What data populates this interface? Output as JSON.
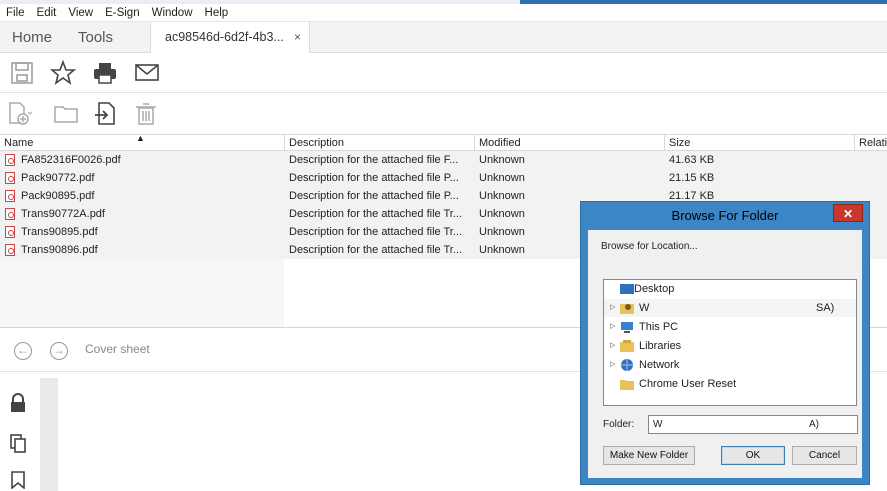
{
  "menu": [
    "File",
    "Edit",
    "View",
    "E-Sign",
    "Window",
    "Help"
  ],
  "tabs": {
    "home": "Home",
    "tools": "Tools",
    "document": "ac98546d-6d2f-4b3...",
    "close": "×"
  },
  "columns": {
    "name": "Name",
    "description": "Description",
    "modified": "Modified",
    "size": "Size",
    "related": "Relati"
  },
  "files": [
    {
      "name": "FA852316F0026.pdf",
      "description": "Description for the attached file F...",
      "modified": "Unknown",
      "size": "41.63 KB"
    },
    {
      "name": "Pack90772.pdf",
      "description": "Description for the attached file P...",
      "modified": "Unknown",
      "size": "21.15 KB"
    },
    {
      "name": "Pack90895.pdf",
      "description": "Description for the attached file P...",
      "modified": "Unknown",
      "size": "21.17 KB"
    },
    {
      "name": "Trans90772A.pdf",
      "description": "Description for the attached file Tr...",
      "modified": "Unknown",
      "size": ""
    },
    {
      "name": "Trans90895.pdf",
      "description": "Description for the attached file Tr...",
      "modified": "Unknown",
      "size": ""
    },
    {
      "name": "Trans90896.pdf",
      "description": "Description for the attached file Tr...",
      "modified": "Unknown",
      "size": ""
    }
  ],
  "page_nav": {
    "cover_sheet": "Cover sheet"
  },
  "dialog": {
    "title": "Browse For Folder",
    "close": "✕",
    "prompt": "Browse for Location...",
    "tree": [
      {
        "label": "Desktop",
        "icon": "desktop-icon",
        "arrow": ""
      },
      {
        "label": "W",
        "suffix": "SA)",
        "icon": "user-folder-icon",
        "arrow": "▷"
      },
      {
        "label": "This PC",
        "icon": "computer-icon",
        "arrow": "▷"
      },
      {
        "label": "Libraries",
        "icon": "libraries-icon",
        "arrow": "▷"
      },
      {
        "label": "Network",
        "icon": "network-icon",
        "arrow": "▷"
      },
      {
        "label": "Chrome User Reset",
        "icon": "folder-icon",
        "arrow": ""
      }
    ],
    "folder_label": "Folder:",
    "folder_value": "W",
    "folder_value_suffix": "A)",
    "buttons": {
      "new_folder": "Make New Folder",
      "ok": "OK",
      "cancel": "Cancel"
    }
  },
  "colors": {
    "dialog_frame": "#3d86c6",
    "close_button": "#c8382a",
    "row_bg": "#f2f2f2"
  }
}
